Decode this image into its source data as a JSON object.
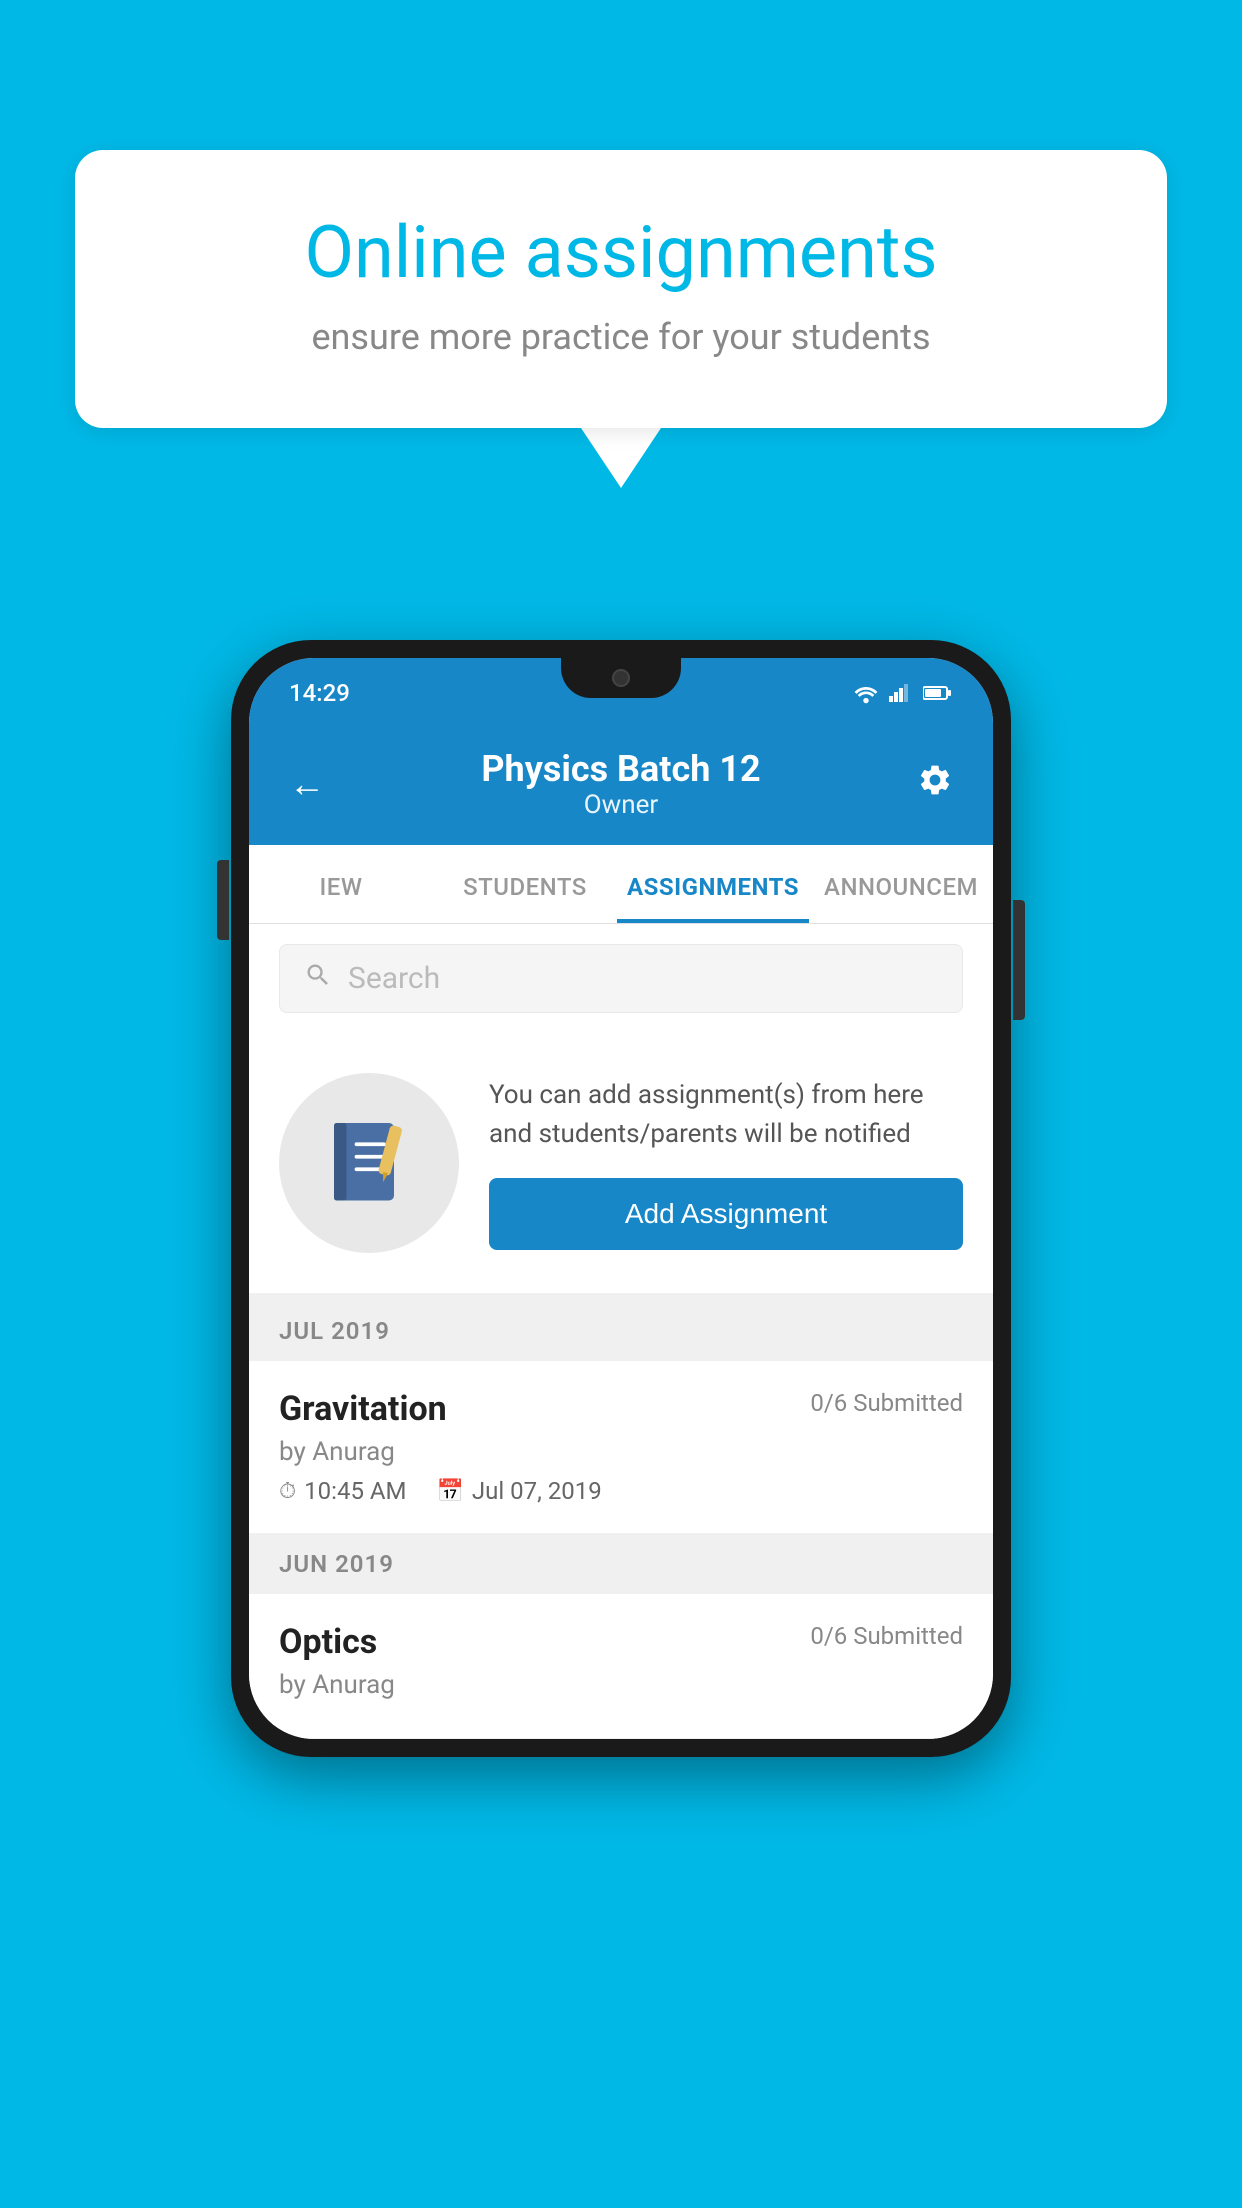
{
  "background_color": "#00B8E6",
  "speech_bubble": {
    "title": "Online assignments",
    "subtitle": "ensure more practice for your students"
  },
  "phone": {
    "status_bar": {
      "time": "14:29",
      "icons": [
        "wifi",
        "signal",
        "battery"
      ]
    },
    "header": {
      "title": "Physics Batch 12",
      "subtitle": "Owner",
      "back_label": "←",
      "settings_label": "⚙"
    },
    "tabs": [
      {
        "label": "IEW",
        "active": false
      },
      {
        "label": "STUDENTS",
        "active": false
      },
      {
        "label": "ASSIGNMENTS",
        "active": true
      },
      {
        "label": "ANNOUNCEM",
        "active": false
      }
    ],
    "search": {
      "placeholder": "Search"
    },
    "promo": {
      "text": "You can add assignment(s) from here and students/parents will be notified",
      "button_label": "Add Assignment"
    },
    "sections": [
      {
        "month": "JUL 2019",
        "assignments": [
          {
            "name": "Gravitation",
            "submitted": "0/6 Submitted",
            "by": "by Anurag",
            "time": "10:45 AM",
            "date": "Jul 07, 2019"
          }
        ]
      },
      {
        "month": "JUN 2019",
        "assignments": [
          {
            "name": "Optics",
            "submitted": "0/6 Submitted",
            "by": "by Anurag",
            "time": "",
            "date": ""
          }
        ]
      }
    ]
  }
}
